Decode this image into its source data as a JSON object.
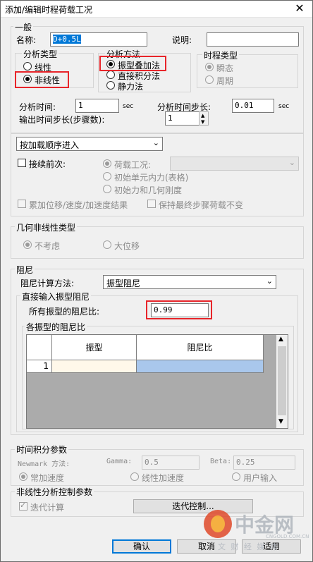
{
  "window": {
    "title": "添加/编辑时程荷载工况",
    "close_glyph": "✕"
  },
  "general": {
    "group_label": "一般",
    "name_label": "名称:",
    "name_value": "D+0.5L",
    "desc_label": "说明:",
    "desc_value": ""
  },
  "analysis_type": {
    "label": "分析类型",
    "options": [
      "线性",
      "非线性"
    ],
    "selected": "非线性"
  },
  "analysis_method": {
    "label": "分析方法",
    "options": [
      "振型叠加法",
      "直接积分法",
      "静力法"
    ],
    "selected": "振型叠加法"
  },
  "time_type": {
    "label": "时程类型",
    "options": [
      "瞬态",
      "周期"
    ],
    "selected": "瞬态"
  },
  "timing": {
    "time_label": "分析时间:",
    "time_value": "1",
    "time_unit": "sec",
    "step_label": "分析时间步长:",
    "step_value": "0.01",
    "step_unit": "sec",
    "output_label": "输出时间步长(步骤数):",
    "output_value": "1"
  },
  "sequence": {
    "select_value": "按加载顺序进入",
    "continue_label": "接续前次:",
    "load_case_label": "荷载工况:",
    "init_force_label": "初始单元内力(表格)",
    "init_stiffness_label": "初始力和几何刚度",
    "cumulative_label": "累加位移/速度/加速度结果",
    "keep_final_label": "保持最终步骤荷载不变"
  },
  "geometric_nonlinear": {
    "label": "几何非线性类型",
    "options": [
      "不考虑",
      "大位移"
    ],
    "selected": "不考虑"
  },
  "damping": {
    "label": "阻尼",
    "method_label": "阻尼计算方法:",
    "method_value": "振型阻尼",
    "direct_label": "直接输入振型阻尼",
    "all_modes_label": "所有振型的阻尼比:",
    "all_modes_value": "0.99",
    "each_mode_label": "各振型的阻尼比",
    "table_headers": [
      "振型",
      "阻尼比"
    ],
    "table_rows": [
      {
        "index": "1",
        "mode": "",
        "ratio": ""
      }
    ]
  },
  "time_integration": {
    "label": "时间积分参数",
    "newmark_label": "Newmark 方法:",
    "gamma_label": "Gamma:",
    "gamma_value": "0.5",
    "beta_label": "Beta:",
    "beta_value": "0.25",
    "options": [
      "常加速度",
      "线性加速度",
      "用户输入"
    ],
    "selected": "常加速度"
  },
  "nonlinear_control": {
    "label": "非线性分析控制参数",
    "iteration_label": "迭代计算",
    "iteration_checked": true,
    "iteration_button": "迭代控制..."
  },
  "buttons": {
    "ok": "确认",
    "cancel": "取消",
    "apply": "适用"
  },
  "watermark": {
    "brand": "中金网",
    "url": "CNGOLD.COM.CN",
    "sub": "文 财 经 媒 体"
  },
  "colors": {
    "highlight_red": "#e8252a",
    "default_button_border": "#0078d7",
    "ratio_cell": "#a9c7ec",
    "mode_cell": "#fff8ea"
  }
}
